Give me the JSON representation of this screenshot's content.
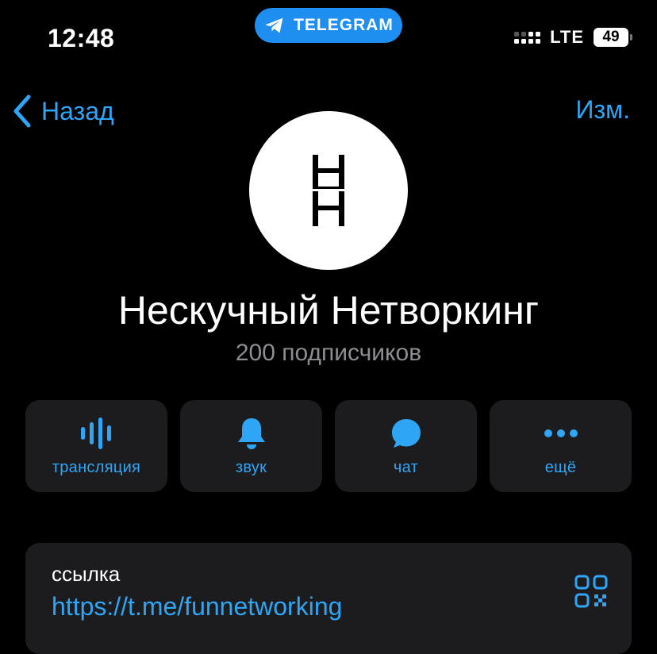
{
  "status_bar": {
    "time": "12:48",
    "app_name": "TELEGRAM",
    "network": "LTE",
    "battery": "49"
  },
  "nav": {
    "back_label": "Назад",
    "edit_label": "Изм."
  },
  "channel": {
    "name": "Нескучный Нетворкинг",
    "subscribers": "200 подписчиков",
    "avatar_icon": "hh-logo"
  },
  "actions": [
    {
      "label": "трансляция",
      "icon": "live-stream-icon"
    },
    {
      "label": "звук",
      "icon": "bell-icon"
    },
    {
      "label": "чат",
      "icon": "chat-bubble-icon"
    },
    {
      "label": "ещё",
      "icon": "more-dots-icon"
    }
  ],
  "link": {
    "caption": "ссылка",
    "url": "https://t.me/funnetworking",
    "icon": "qr-code-icon"
  },
  "colors": {
    "accent": "#2ea6f5",
    "pill": "#1f8ef1",
    "card": "#1c1c1e",
    "secondary_text": "#8d8d93"
  }
}
